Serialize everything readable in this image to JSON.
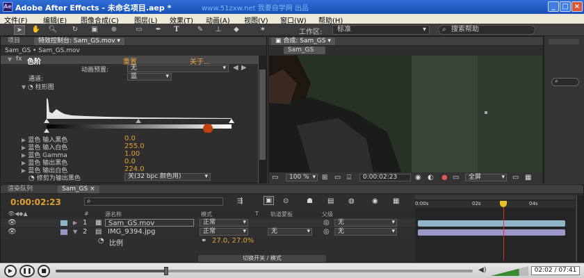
{
  "window": {
    "title": "Adobe After Effects - 未命名项目.aep *",
    "watermark": "www.51zxw.net 我要自学网 出品",
    "app_icon": "Ae"
  },
  "menu": [
    "文件(F)",
    "编辑(E)",
    "图像合成(C)",
    "图层(L)",
    "效果(T)",
    "动画(A)",
    "视图(V)",
    "窗口(W)",
    "帮助(H)"
  ],
  "toolbar": {
    "tools": [
      "selection-tool",
      "hand-tool",
      "zoom-tool",
      "rotate-tool",
      "camera-tool",
      "pan-behind-tool",
      "rectangle-tool",
      "pen-tool",
      "type-tool",
      "brush-tool",
      "clone-tool",
      "eraser-tool",
      "puppet-tool"
    ],
    "workspace_label": "工作区:",
    "workspace_value": "标准",
    "search_placeholder": "搜索帮助"
  },
  "project_tabs": {
    "project": "项目",
    "effects": "特效控制台: Sam_GS.mov"
  },
  "effects": {
    "breadcrumb": "Sam_GS • Sam_GS.mov",
    "effect_name": "色阶",
    "reset": "重置",
    "about": "关于...",
    "preset_label": "动画预置:",
    "preset_value": "无",
    "channel_label": "通道:",
    "channel_value": "蓝",
    "histogram_label": "柱形图",
    "params": [
      {
        "label": "蓝色 输入黑色",
        "value": "0.0"
      },
      {
        "label": "蓝色 输入白色",
        "value": "255.0"
      },
      {
        "label": "蓝色 Gamma",
        "value": "1.00"
      },
      {
        "label": "蓝色 输出黑色",
        "value": "0.0"
      },
      {
        "label": "蓝色 输出白色",
        "value": "224.0"
      }
    ],
    "clip_label": "修剪为输出黑色",
    "clip_value": "关(32 bpc 颜色用)"
  },
  "comp": {
    "tab": "合成: Sam_GS",
    "subtab": "Sam_GS",
    "zoom": "100 %",
    "timecode": "0:00:02:23",
    "resolution": "全屏"
  },
  "timeline": {
    "tabs": [
      "渲染队列",
      "Sam_GS"
    ],
    "timecode": "0:00:02:23",
    "search_placeholder": "",
    "columns": {
      "num": "#",
      "name": "源名称",
      "mode": "模式",
      "t": "T",
      "trkmat": "轨道蒙板",
      "parent": "父级"
    },
    "layers": [
      {
        "num": "1",
        "name": "Sam_GS.mov",
        "mode": "正常",
        "trkmat": "",
        "parent": "无",
        "color": "#8fb5c9"
      },
      {
        "num": "2",
        "name": "IMG_9394.jpg",
        "mode": "正常",
        "trkmat": "无",
        "parent": "无",
        "color": "#9a96c8"
      }
    ],
    "scale_label": "比例",
    "scale_value": "27.0, 27.0%",
    "ruler": [
      "0:00s",
      "02s",
      "04s"
    ],
    "toggle_label": "切换开关 / 模式",
    "playhead_fraction": 0.37
  },
  "player": {
    "time": "02:02 / 07:41",
    "progress": 0.265,
    "volume": 0.75
  },
  "colors": {
    "accent": "#e8a33a",
    "playhead": "#e03030",
    "titlebar": "#1a4fb8"
  }
}
